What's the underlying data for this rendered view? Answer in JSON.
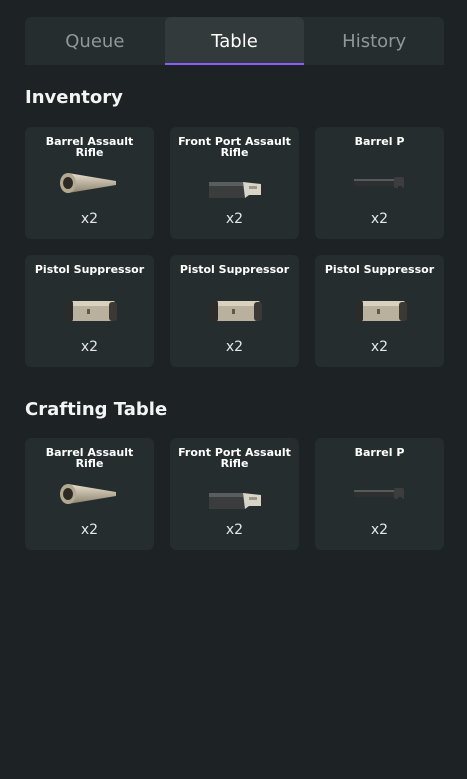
{
  "tabs": [
    {
      "label": "Queue",
      "active": false
    },
    {
      "label": "Table",
      "active": true
    },
    {
      "label": "History",
      "active": false
    }
  ],
  "accent_color": "#8c5cf6",
  "inventory": {
    "title": "Inventory",
    "items": [
      {
        "name": "Barrel Assault Rifle",
        "qty": "x2",
        "icon": "barrel-icon"
      },
      {
        "name": "Front Port Assault Rifle",
        "qty": "x2",
        "icon": "front-port-icon"
      },
      {
        "name": "Barrel P",
        "qty": "x2",
        "icon": "barrel-p-icon"
      },
      {
        "name": "Pistol Suppressor",
        "qty": "x2",
        "icon": "suppressor-icon"
      },
      {
        "name": "Pistol Suppressor",
        "qty": "x2",
        "icon": "suppressor-icon"
      },
      {
        "name": "Pistol Suppressor",
        "qty": "x2",
        "icon": "suppressor-icon"
      }
    ]
  },
  "crafting": {
    "title": "Crafting Table",
    "items": [
      {
        "name": "Barrel Assault Rifle",
        "qty": "x2",
        "icon": "barrel-icon"
      },
      {
        "name": "Front Port Assault Rifle",
        "qty": "x2",
        "icon": "front-port-icon"
      },
      {
        "name": "Barrel P",
        "qty": "x2",
        "icon": "barrel-p-icon"
      }
    ]
  }
}
